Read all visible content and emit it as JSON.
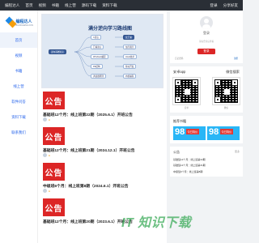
{
  "topbar": {
    "nav": [
      "编程达人",
      "首页",
      "视频",
      "书籍",
      "线上营",
      "源码下载",
      "资料下载"
    ],
    "right": [
      "登录",
      "分享好友"
    ]
  },
  "logo": {
    "name": "编程达人",
    "sub": "BIANCHENG.FUN"
  },
  "sidebar": {
    "items": [
      "首页",
      "视频",
      "书籍",
      "线上营",
      "软件问答",
      "资料下载",
      "联系我们"
    ]
  },
  "hero": {
    "title": "满分逆向学习路线图",
    "nodes": [
      "逆向基础知识",
      "C语言",
      "汇编语言",
      "Windows编程",
      "PE结构",
      "调试器原理",
      "反汇编",
      "加壳脱壳",
      "Hook技术",
      "驱动开发",
      "内核编程"
    ]
  },
  "posts": [
    {
      "banner": "公告",
      "title": "基础班12个月：线上班第22期（2025.6.1）开班公告",
      "author": "",
      "date": ""
    },
    {
      "banner": "公告",
      "title": "基础班12个月：线上班第21期（2024.12.1）开班公告",
      "author": "",
      "date": ""
    },
    {
      "banner": "公告",
      "title": "中级班6个月：线上班第8期（2024.6.1）开班公告",
      "author": "",
      "date": ""
    },
    {
      "banner": "公告",
      "title": "基础班12个月：线上班第20期（2023.6.1）开班公告",
      "author": "",
      "date": ""
    }
  ],
  "login": {
    "title": "",
    "username": "登录",
    "hint": "请先登录后查看",
    "button": "登录",
    "left_tip": "忘记密码",
    "right_tip": "注册"
  },
  "qr": {
    "title": "安卓app",
    "title2": "微信搜索",
    "label1": "安卓",
    "label2": "微信"
  },
  "ads": {
    "title": "推荐书籍",
    "items": [
      {
        "big": "98",
        "label": "今日特价",
        "sub": ""
      },
      {
        "big": "98",
        "label": "今日特价",
        "sub": ""
      }
    ]
  },
  "notice": {
    "title": "公告",
    "more": "更多",
    "lines": [
      "基础班12个月：线上班第22期",
      "基础班12个月：线上班第21期",
      "中级班6个月：线上班第8期"
    ]
  },
  "watermark": "IT 知识下载"
}
